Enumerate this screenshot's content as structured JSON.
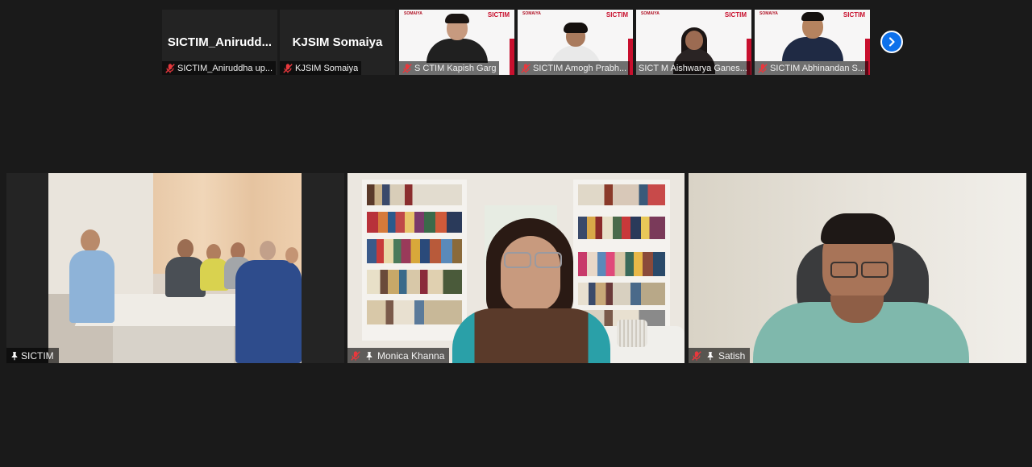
{
  "thumbnails": [
    {
      "big_name": "SICTIM_Anirudd...",
      "label": "SICTIM_Aniruddha up...",
      "muted": true,
      "video": false
    },
    {
      "big_name": "KJSIM Somaiya",
      "label": "KJSIM Somaiya",
      "muted": true,
      "video": false
    },
    {
      "label": "S CTIM Kapish Garg",
      "muted": true,
      "video": true,
      "brand_left": "SOMAIYA",
      "brand_right": "SICTIM"
    },
    {
      "label": "SICTIM Amogh Prabh...",
      "muted": true,
      "video": true,
      "brand_left": "SOMAIYA",
      "brand_right": "SICTIM"
    },
    {
      "label": "SICT M Aishwarya Ganes...",
      "muted": false,
      "video": true,
      "brand_left": "SOMAIYA",
      "brand_right": "SICTIM"
    },
    {
      "label": "SICTIM Abhinandan S...",
      "muted": true,
      "video": true,
      "brand_left": "SOMAIYA",
      "brand_right": "SICTIM"
    }
  ],
  "next_page_icon": "chevron-right-icon",
  "tiles": [
    {
      "label": "SICTIM",
      "muted": false,
      "pinned": true
    },
    {
      "label": "Monica Khanna",
      "muted": true,
      "pinned": true
    },
    {
      "label": "Satish",
      "muted": true,
      "pinned": true
    }
  ],
  "colors": {
    "background": "#1a1a1a",
    "accent_blue": "#0e71eb",
    "muted_red": "#e8383d",
    "brand_red": "#c8102e"
  }
}
